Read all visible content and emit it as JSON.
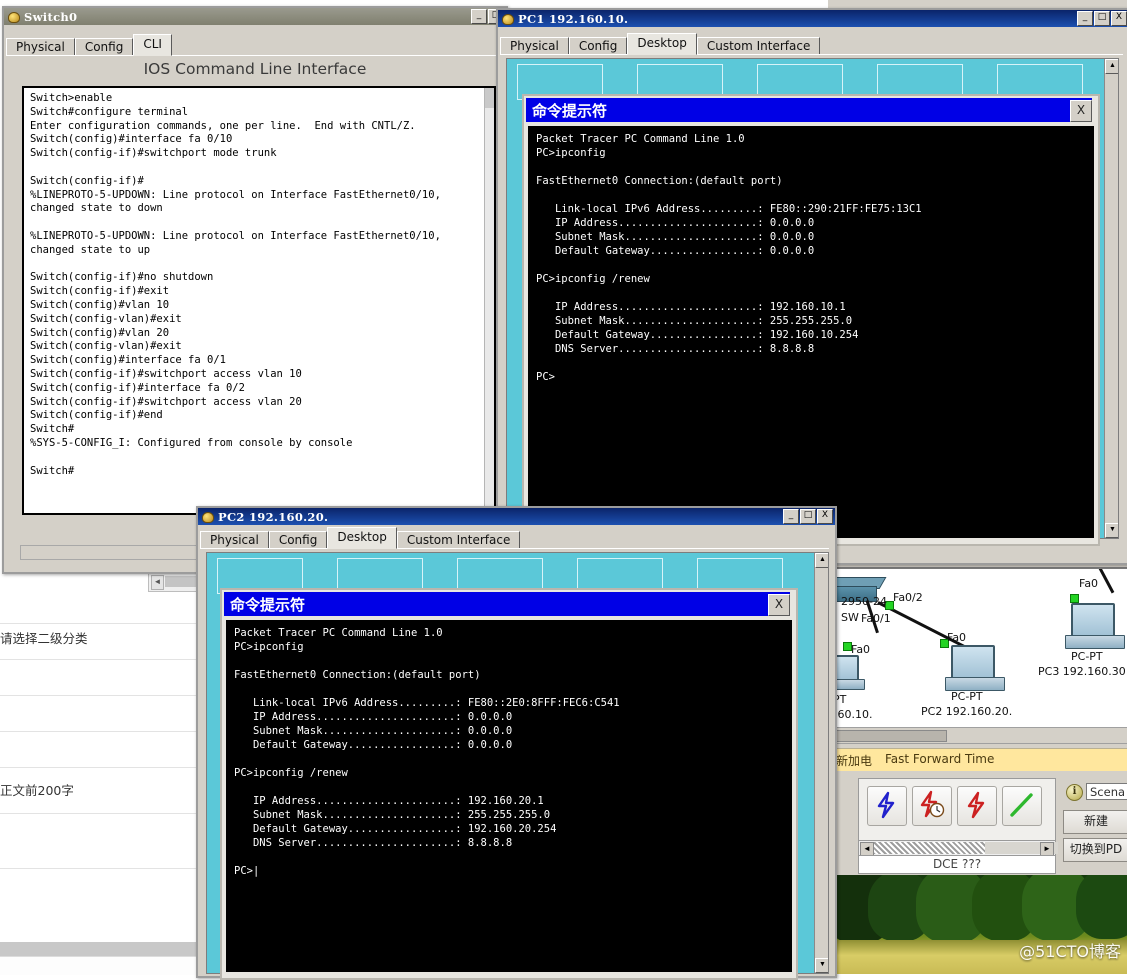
{
  "webpage": {
    "field_label_category": "请选择二级分类",
    "field_label_summary": "正文前200字"
  },
  "switch_window": {
    "title": "Switch0",
    "icon": "packet-tracer-icon",
    "window_buttons": [
      "_",
      "□",
      "X"
    ],
    "tabs": [
      {
        "label": "Physical",
        "selected": false
      },
      {
        "label": "Config",
        "selected": false
      },
      {
        "label": "CLI",
        "selected": true
      }
    ],
    "heading": "IOS Command Line Interface",
    "cli_text": "Switch>enable\nSwitch#configure terminal\nEnter configuration commands, one per line.  End with CNTL/Z.\nSwitch(config)#interface fa 0/10\nSwitch(config-if)#switchport mode trunk\n\nSwitch(config-if)#\n%LINEPROTO-5-UPDOWN: Line protocol on Interface FastEthernet0/10,\nchanged state to down\n\n%LINEPROTO-5-UPDOWN: Line protocol on Interface FastEthernet0/10,\nchanged state to up\n\nSwitch(config-if)#no shutdown\nSwitch(config-if)#exit\nSwitch(config)#vlan 10\nSwitch(config-vlan)#exit\nSwitch(config)#vlan 20\nSwitch(config-vlan)#exit\nSwitch(config)#interface fa 0/1\nSwitch(config-if)#switchport access vlan 10\nSwitch(config-if)#interface fa 0/2\nSwitch(config-if)#switchport access vlan 20\nSwitch(config-if)#end\nSwitch#\n%SYS-5-CONFIG_I: Configured from console by console\n\nSwitch#"
  },
  "pc1_window": {
    "title": "PC1   192.160.10.",
    "icon": "packet-tracer-icon",
    "window_buttons": [
      "_",
      "□",
      "X"
    ],
    "tabs": [
      {
        "label": "Physical",
        "selected": false
      },
      {
        "label": "Config",
        "selected": false
      },
      {
        "label": "Desktop",
        "selected": true
      },
      {
        "label": "Custom Interface",
        "selected": false
      }
    ],
    "command_prompt": {
      "title": "命令提示符",
      "close_label": "X",
      "text": "Packet Tracer PC Command Line 1.0\nPC>ipconfig\n\nFastEthernet0 Connection:(default port)\n\n   Link-local IPv6 Address.........: FE80::290:21FF:FE75:13C1\n   IP Address......................: 0.0.0.0\n   Subnet Mask.....................: 0.0.0.0\n   Default Gateway.................: 0.0.0.0\n\nPC>ipconfig /renew\n\n   IP Address......................: 192.160.10.1\n   Subnet Mask.....................: 255.255.255.0\n   Default Gateway.................: 192.160.10.254\n   DNS Server......................: 8.8.8.8\n\nPC>"
    }
  },
  "pc2_window": {
    "title": "PC2   192.160.20.",
    "icon": "packet-tracer-icon",
    "window_buttons": [
      "_",
      "□",
      "X"
    ],
    "tabs": [
      {
        "label": "Physical",
        "selected": false
      },
      {
        "label": "Config",
        "selected": false
      },
      {
        "label": "Desktop",
        "selected": true
      },
      {
        "label": "Custom Interface",
        "selected": false
      }
    ],
    "command_prompt": {
      "title": "命令提示符",
      "close_label": "X",
      "text": "Packet Tracer PC Command Line 1.0\nPC>ipconfig\n\nFastEthernet0 Connection:(default port)\n\n   Link-local IPv6 Address.........: FE80::2E0:8FFF:FEC6:C541\n   IP Address......................: 0.0.0.0\n   Subnet Mask.....................: 0.0.0.0\n   Default Gateway.................: 0.0.0.0\n\nPC>ipconfig /renew\n\n   IP Address......................: 192.160.20.1\n   Subnet Mask.....................: 255.255.255.0\n   Default Gateway.................: 192.160.20.254\n   DNS Server......................: 8.8.8.8\n\nPC>|"
    }
  },
  "packet_tracer": {
    "topology": {
      "switch_label_line1": "2950-24",
      "switch_label_line2": "SW",
      "port_fa02": "Fa0/2",
      "port_fa01": "Fa0/1",
      "pc1_port": "Fa0",
      "pc2_port": "Fa0",
      "pc3_port": "Fa0",
      "pc1_model": "-PT",
      "pc1_name": ".160.10.",
      "pc2_model": "PC-PT",
      "pc2_name": "PC2  192.160.20.",
      "pc3_model": "PC-PT",
      "pc3_name": "PC3 192.160.30"
    },
    "realtime_bar": {
      "label_cn": "新加电",
      "label_en": "Fast Forward Time"
    },
    "tools": [
      {
        "name": "add-simple-pdu-icon",
        "color": "#2121cc"
      },
      {
        "name": "add-complex-pdu-icon",
        "color": "#cc2121"
      },
      {
        "name": "delete-pdu-icon",
        "color": "#cc2121"
      },
      {
        "name": "line-tool-icon",
        "color": "#2eb82e"
      }
    ],
    "dce_label": "DCE ???",
    "scenario_value": "Scena",
    "info_icon": "info-icon",
    "buttons": [
      {
        "label": "新建"
      },
      {
        "label": "切换到PD"
      }
    ],
    "scroll_left_arrow": "◄",
    "scroll_right_arrow": "►"
  },
  "watermark": "@51CTO博客",
  "colors": {
    "titlebar_active": "#0a246a",
    "titlebar_inactive": "#8d8d7e",
    "cmd_title_blue": "#0000e6",
    "desktop_strip": "#5bc8d8",
    "app_face": "#d4d0c8",
    "realtime_yellow": "#ffe79e"
  }
}
